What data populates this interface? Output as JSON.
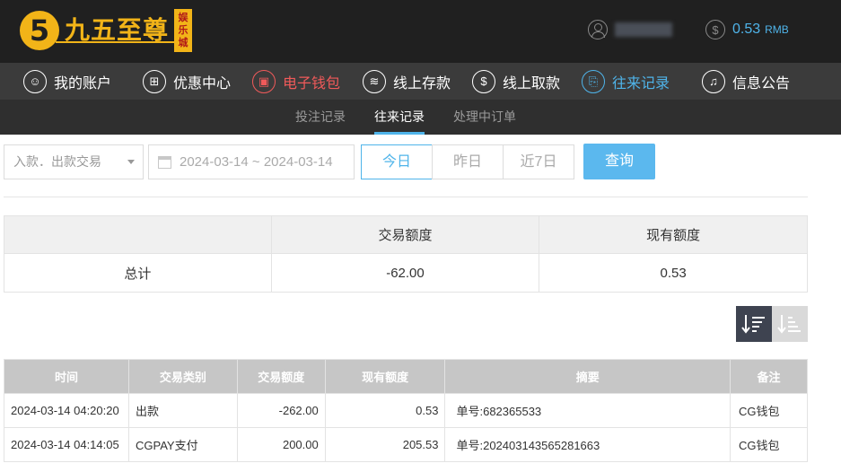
{
  "header": {
    "logo_digit": "5",
    "logo_text": "九五至尊",
    "logo_seal": [
      "娱",
      "乐",
      "城"
    ],
    "balance_amount": "0.53",
    "balance_unit": "RMB"
  },
  "nav": [
    {
      "label": "我的账户",
      "icon": "user-icon",
      "state": "normal"
    },
    {
      "label": "优惠中心",
      "icon": "gift-icon",
      "state": "normal"
    },
    {
      "label": "电子钱包",
      "icon": "wallet-icon",
      "state": "highlight"
    },
    {
      "label": "线上存款",
      "icon": "deposit-icon",
      "state": "normal"
    },
    {
      "label": "线上取款",
      "icon": "withdraw-icon",
      "state": "normal"
    },
    {
      "label": "往来记录",
      "icon": "records-icon",
      "state": "active"
    },
    {
      "label": "信息公告",
      "icon": "bell-icon",
      "state": "normal"
    }
  ],
  "subnav": [
    {
      "label": "投注记录",
      "active": false
    },
    {
      "label": "往来记录",
      "active": true
    },
    {
      "label": "处理中订单",
      "active": false
    }
  ],
  "filters": {
    "type_select": "入款．出款交易",
    "date_range": "2024-03-14 ~ 2024-03-14",
    "ranges": [
      "今日",
      "昨日",
      "近7日"
    ],
    "active_range": "今日",
    "query_label": "查询"
  },
  "summary": {
    "headers": [
      "",
      "交易额度",
      "现有额度"
    ],
    "row": {
      "label": "总计",
      "amount": "-62.00",
      "balance": "0.53"
    }
  },
  "records": {
    "headers": [
      "时间",
      "交易类别",
      "交易额度",
      "现有额度",
      "摘要",
      "备注"
    ],
    "rows": [
      {
        "time": "2024-03-14 04:20:20",
        "type": "出款",
        "amount": "-262.00",
        "balance": "0.53",
        "summary": "单号:682365533",
        "note": "CG钱包"
      },
      {
        "time": "2024-03-14 04:14:05",
        "type": "CGPAY支付",
        "amount": "200.00",
        "balance": "205.53",
        "summary": "单号:202403143565281663",
        "note": "CG钱包"
      }
    ]
  },
  "colors": {
    "accent": "#4fb4ea",
    "highlight": "#f05a5a",
    "gold": "#f2b418"
  }
}
